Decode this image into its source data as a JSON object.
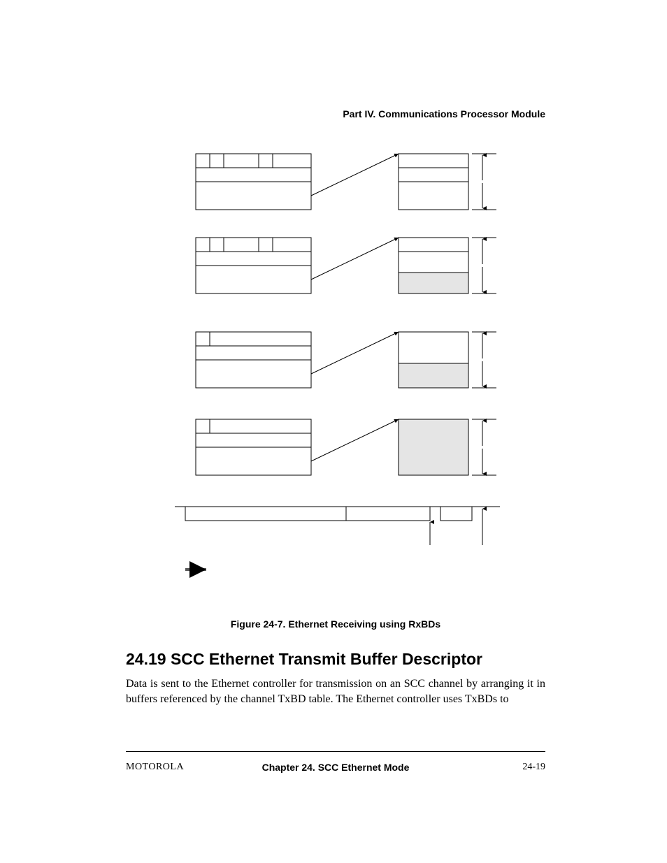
{
  "header": {
    "part": "Part IV.  Communications Processor Module"
  },
  "figure": {
    "caption": "Figure 24-7. Ethernet Receiving using RxBDs"
  },
  "section": {
    "heading": "24.19  SCC Ethernet Transmit Buffer Descriptor",
    "paragraph": "Data is sent to the Ethernet controller for transmission on an SCC channel by arranging it in buffers referenced by the channel TxBD table. The Ethernet controller uses TxBDs to"
  },
  "footer": {
    "left": "MOTOROLA",
    "center": "Chapter 24.  SCC Ethernet Mode",
    "right": "24-19"
  }
}
